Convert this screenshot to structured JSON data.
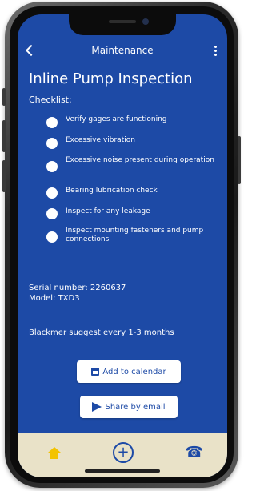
{
  "header": {
    "title": "Maintenance"
  },
  "page": {
    "title": "Inline Pump Inspection",
    "checklist_label": "Checklist:"
  },
  "checklist": [
    "Verify gages are functioning",
    "Excessive vibration",
    "Excessive noise present during operation",
    "Bearing lubrication check",
    "Inspect for any leakage",
    "Inspect mounting fasteners and pump connections"
  ],
  "info": {
    "serial": "Serial number: 2260637",
    "model": "Model: TXD3",
    "suggestion": "Blackmer suggest every 1-3 months"
  },
  "actions": {
    "calendar_label": "Add to calendar",
    "email_label": "Share by email"
  },
  "nav": {
    "add_symbol": "+",
    "phone_symbol": "☎"
  },
  "colors": {
    "primary": "#1d4aa6",
    "nav_bg": "#e9e2c8",
    "home_accent": "#f3c300"
  }
}
